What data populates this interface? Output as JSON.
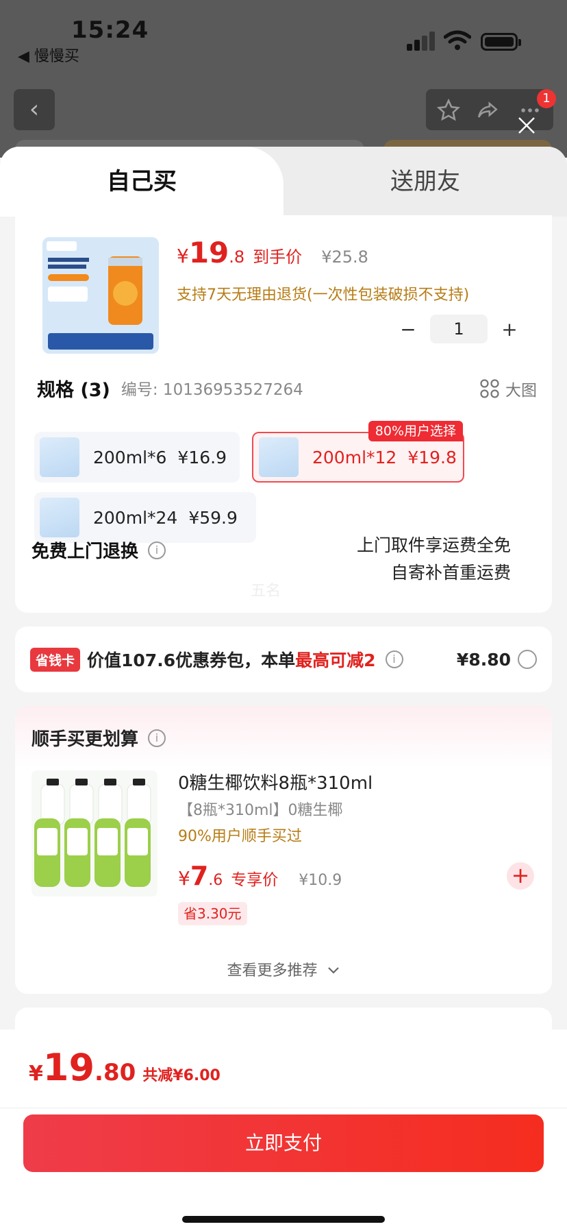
{
  "status": {
    "time": "15:24",
    "back_app": "◀ 慢慢买"
  },
  "header": {
    "notification_count": "1"
  },
  "tabs": {
    "self": "自己买",
    "gift": "送朋友"
  },
  "product": {
    "currency": "¥",
    "price_int": "19",
    "price_dec": ".8",
    "price_tag": "到手价",
    "orig_price": "¥25.8",
    "return_note": "支持7天无理由退货(一次性包装破损不支持)",
    "qty_minus": "−",
    "qty": "1",
    "qty_plus": "+"
  },
  "spec": {
    "title": "规格 (3)",
    "number": "编号: 10136953527264",
    "big_view": "大图",
    "options": [
      {
        "size": "200ml*6",
        "price": "¥16.9",
        "selected": false
      },
      {
        "size": "200ml*12",
        "price": "¥19.8",
        "selected": true,
        "badge": "80%用户选择"
      },
      {
        "size": "200ml*24",
        "price": "¥59.9",
        "selected": false
      }
    ]
  },
  "free_return": {
    "label": "免费上门退换",
    "line1": "上门取件享运费全免",
    "line2": "自寄补首重运费",
    "watermark": "五名"
  },
  "coupon": {
    "tag": "省钱卡",
    "text": "价值107.6优惠券包，本单",
    "highlight": "最高可减2",
    "amount": "¥8.80"
  },
  "addon": {
    "title": "顺手买更划算",
    "name": "0糖生椰饮料8瓶*310ml",
    "sub": "【8瓶*310ml】0糖生椰",
    "popular": "90%用户顺手买过",
    "currency": "¥",
    "price_int": "7",
    "price_dec": ".6",
    "price_tag": "专享价",
    "orig_price": "¥10.9",
    "save": "省3.30元",
    "more": "查看更多推荐"
  },
  "footer": {
    "currency": "¥",
    "total_int": "19",
    "total_dec": ".80",
    "saved": "共减¥6.00",
    "pay": "立即支付"
  },
  "colors": {
    "accent": "#e0221f",
    "gold": "#b77c15"
  },
  "icons": [
    "back-icon",
    "star-icon",
    "share-icon",
    "more-icon",
    "close-icon",
    "grid-icon",
    "info-icon",
    "chevron-down-icon",
    "plus-icon"
  ]
}
